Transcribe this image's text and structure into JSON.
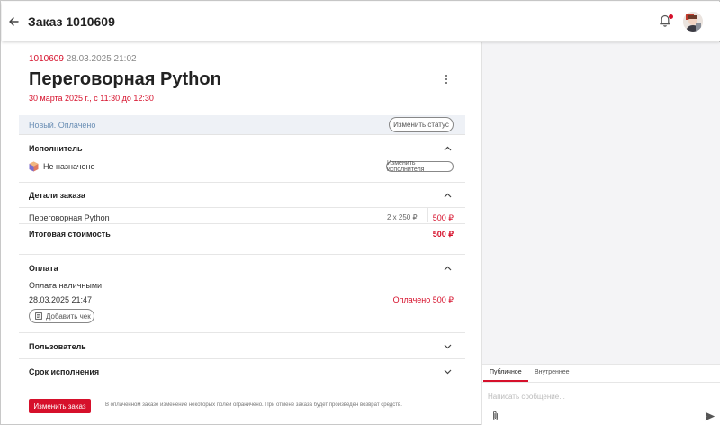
{
  "header": {
    "title": "Заказ 1010609",
    "back_icon": "arrow-left-icon",
    "bell_icon": "bell-icon",
    "accent": "#d6102b"
  },
  "order": {
    "number": "1010609",
    "datetime": "28.03.2025 21:02",
    "title": "Переговорная Python",
    "time_slot": "30 марта 2025 г., с 11:30 до 12:30"
  },
  "status": {
    "text": "Новый. Оплачено",
    "change_label": "Изменить статус"
  },
  "executor": {
    "heading": "Исполнитель",
    "value": "Не назначено",
    "change_label": "Изменить исполнителя"
  },
  "details": {
    "heading": "Детали заказа",
    "item_name": "Переговорная Python",
    "item_qty": "2 x 250 ₽",
    "item_price": "500 ₽",
    "total_label": "Итоговая стоимость",
    "total_value": "500 ₽"
  },
  "payment": {
    "heading": "Оплата",
    "method": "Оплата наличными",
    "date": "28.03.2025 21:47",
    "status": "Оплачено 500 ₽",
    "add_receipt_label": "Добавить чек"
  },
  "user": {
    "heading": "Пользователь"
  },
  "deadline": {
    "heading": "Срок исполнения"
  },
  "footer": {
    "edit_label": "Изменить заказ",
    "note": "В оплаченном заказе изменение некоторых полей ограничено. При отмене заказа будет произведен возврат средств."
  },
  "chat": {
    "tabs": [
      "Публичное",
      "Внутреннее"
    ],
    "placeholder": "Написать сообщение...",
    "attach_icon": "paperclip-icon",
    "send_icon": "send-icon"
  }
}
